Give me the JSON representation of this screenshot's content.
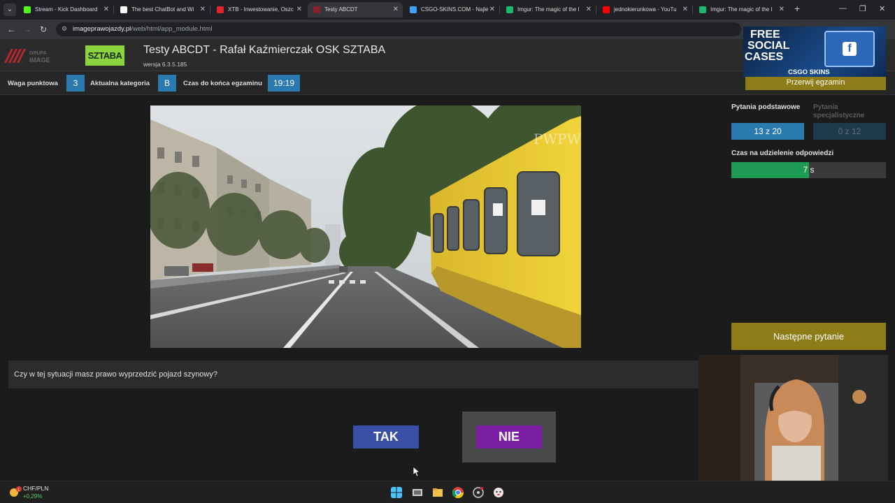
{
  "browser": {
    "tabs": [
      {
        "title": "Stream - Kick Dashboard",
        "favicon_color": "#53fc18",
        "active": false
      },
      {
        "title": "The best ChatBot and Wi",
        "favicon_color": "#ffffff",
        "active": false
      },
      {
        "title": "XTB - Inwestowanie, Oszc",
        "favicon_color": "#e0262d",
        "active": false
      },
      {
        "title": "Testy ABCDT",
        "favicon_color": "#8a1f2e",
        "active": true
      },
      {
        "title": "CSGO-SKINS.COM - Najle",
        "favicon_color": "#3da1ff",
        "active": false
      },
      {
        "title": "Imgur: The magic of the I",
        "favicon_color": "#1bb76e",
        "active": false
      },
      {
        "title": "jednokierunkowa - YouTu",
        "favicon_color": "#ff0000",
        "active": false
      },
      {
        "title": "Imgur: The magic of the I",
        "favicon_color": "#1bb76e",
        "active": false
      }
    ],
    "url_domain": "imageprawojazdy.pl",
    "url_path": "/web/html/app_module.html"
  },
  "header": {
    "logo_left_text": "GRUPA IMAGE",
    "logo_right_text": "SZTABA",
    "title": "Testy ABCDT - Rafał Kaźmierczak OSK SZTABA",
    "version": "wersja 6.3.5.185"
  },
  "infobar": {
    "weight_label": "Waga punktowa",
    "weight_value": "3",
    "category_label": "Aktualna kategoria",
    "category_value": "B",
    "timer_label": "Czas do końca egzaminu",
    "timer_value": "19:19"
  },
  "right_panel": {
    "basic_label": "Pytania podstawowe",
    "basic_value": "13 z 20",
    "special_label": "Pytania specjalistyczne",
    "special_value": "0 z 12",
    "answer_time_label": "Czas na udzielenie odpowiedzi",
    "answer_time_value": "7 s",
    "answer_time_fraction": 0.5,
    "next_button": "Następne pytanie",
    "stop_button": "Przerwij egzamin"
  },
  "ad": {
    "line1": "FREE",
    "line2": "SOCIAL",
    "line3": "CASES",
    "brand": "CSGO SKINS"
  },
  "question": {
    "text": "Czy w tej sytuacji masz prawo wyprzedzić pojazd szynowy?"
  },
  "answers": {
    "yes": "TAK",
    "no": "NIE"
  },
  "video": {
    "watermark": "PWPW"
  },
  "taskbar": {
    "widget_label": "CHF/PLN",
    "widget_value": "+0,29%",
    "widget_badge": "1"
  }
}
